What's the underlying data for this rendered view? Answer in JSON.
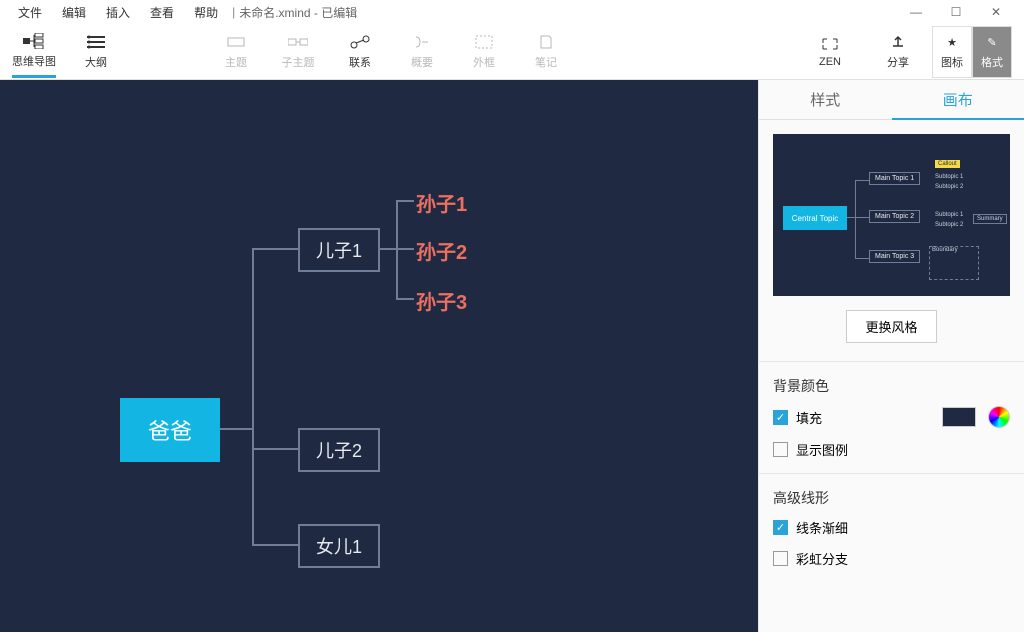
{
  "menu": {
    "file": "文件",
    "edit": "编辑",
    "insert": "插入",
    "view": "查看",
    "help": "帮助"
  },
  "doc": {
    "title": "未命名.xmind - 已编辑"
  },
  "toolbar": {
    "mindmap": "思维导图",
    "outline": "大纲",
    "topic": "主题",
    "subtopic": "子主题",
    "relation": "联系",
    "summary": "概要",
    "boundary": "外框",
    "note": "笔记",
    "zen": "ZEN",
    "share": "分享",
    "icons": "图标",
    "format": "格式"
  },
  "mindmap": {
    "root": "爸爸",
    "sons": [
      "儿子1",
      "儿子2",
      "女儿1"
    ],
    "grands": [
      "孙子1",
      "孙子2",
      "孙子3"
    ]
  },
  "preview": {
    "central": "Central Topic",
    "mains": [
      "Main Topic 1",
      "Main Topic 2",
      "Main Topic 3"
    ],
    "sub": "Subtopic",
    "callout": "Callout",
    "summary": "Summary",
    "boundary": "Boundary"
  },
  "panel": {
    "tabs": {
      "style": "样式",
      "canvas": "画布"
    },
    "change_style": "更换风格",
    "bg_color": "背景颜色",
    "fill": "填充",
    "show_legend": "显示图例",
    "adv_line": "高级线形",
    "line_taper": "线条渐细",
    "rainbow": "彩虹分支",
    "bg_hex": "#1f2a42"
  }
}
